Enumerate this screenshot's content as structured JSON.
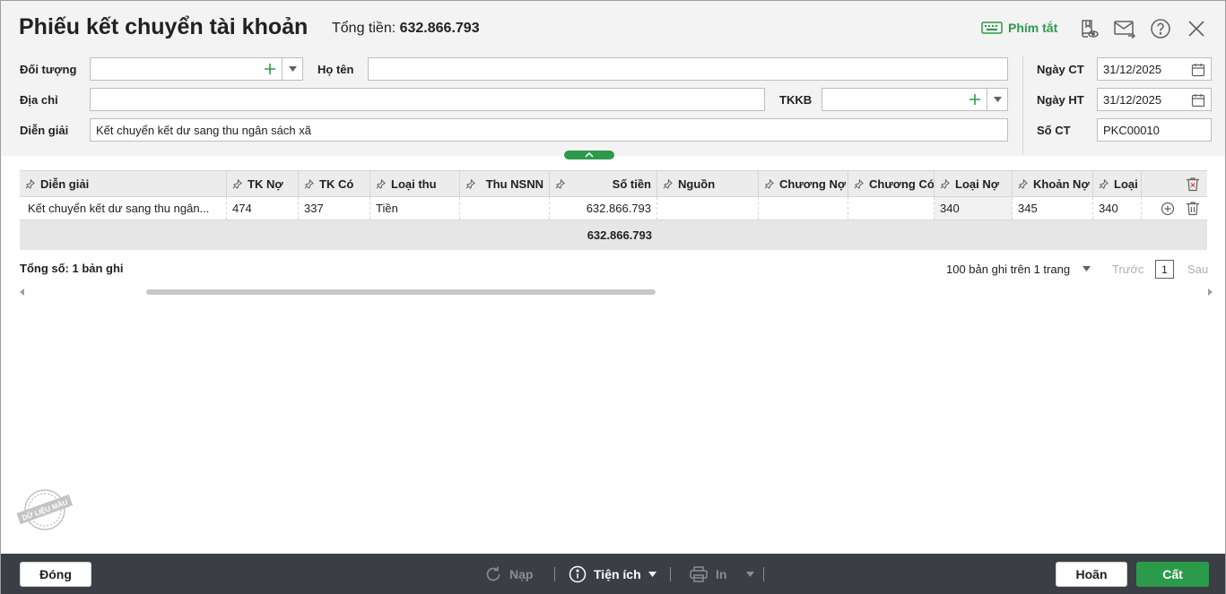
{
  "header": {
    "title": "Phiếu kết chuyển tài khoản",
    "total_label": "Tổng tiền:",
    "total_value": "632.866.793",
    "shortcut_label": "Phím tắt"
  },
  "form": {
    "doi_tuong_label": "Đối tượng",
    "doi_tuong_value": "",
    "ho_ten_label": "Họ tên",
    "ho_ten_value": "",
    "dia_chi_label": "Địa chỉ",
    "dia_chi_value": "",
    "tkkb_label": "TKKB",
    "tkkb_value": "",
    "dien_giai_label": "Diễn giải",
    "dien_giai_value": "Kết chuyển kết dư sang thu ngân sách xã",
    "ngay_ct_label": "Ngày CT",
    "ngay_ct_value": "31/12/2025",
    "ngay_ht_label": "Ngày HT",
    "ngay_ht_value": "31/12/2025",
    "so_ct_label": "Số CT",
    "so_ct_value": "PKC00010"
  },
  "grid": {
    "columns": [
      "Diễn giải",
      "TK Nợ",
      "TK Có",
      "Loại thu",
      "Thu NSNN",
      "Số tiền",
      "Nguồn",
      "Chương Nợ",
      "Chương Có",
      "Loại Nợ",
      "Khoản Nợ",
      "Loại"
    ],
    "rows": [
      [
        "Kết chuyển kết dư sang thu ngân...",
        "474",
        "337",
        "Tiền",
        "",
        "632.866.793",
        "",
        "",
        "",
        "340",
        "345",
        "340"
      ]
    ],
    "sum_amount": "632.866.793"
  },
  "summary": {
    "total_records": "Tổng số: 1 bản ghi",
    "per_page": "100 bản ghi trên 1 trang",
    "prev": "Trước",
    "page": "1",
    "next": "Sau"
  },
  "stamp": {
    "text": "DỮ LIỆU MẪU"
  },
  "footer": {
    "close": "Đóng",
    "reload": "Nạp",
    "utilities": "Tiện ích",
    "print": "In",
    "cancel": "Hoãn",
    "save": "Cất"
  },
  "colors": {
    "accent": "#2c9a4b",
    "footer_bg": "#3b3f45",
    "header_bg": "#f3f3f3"
  }
}
